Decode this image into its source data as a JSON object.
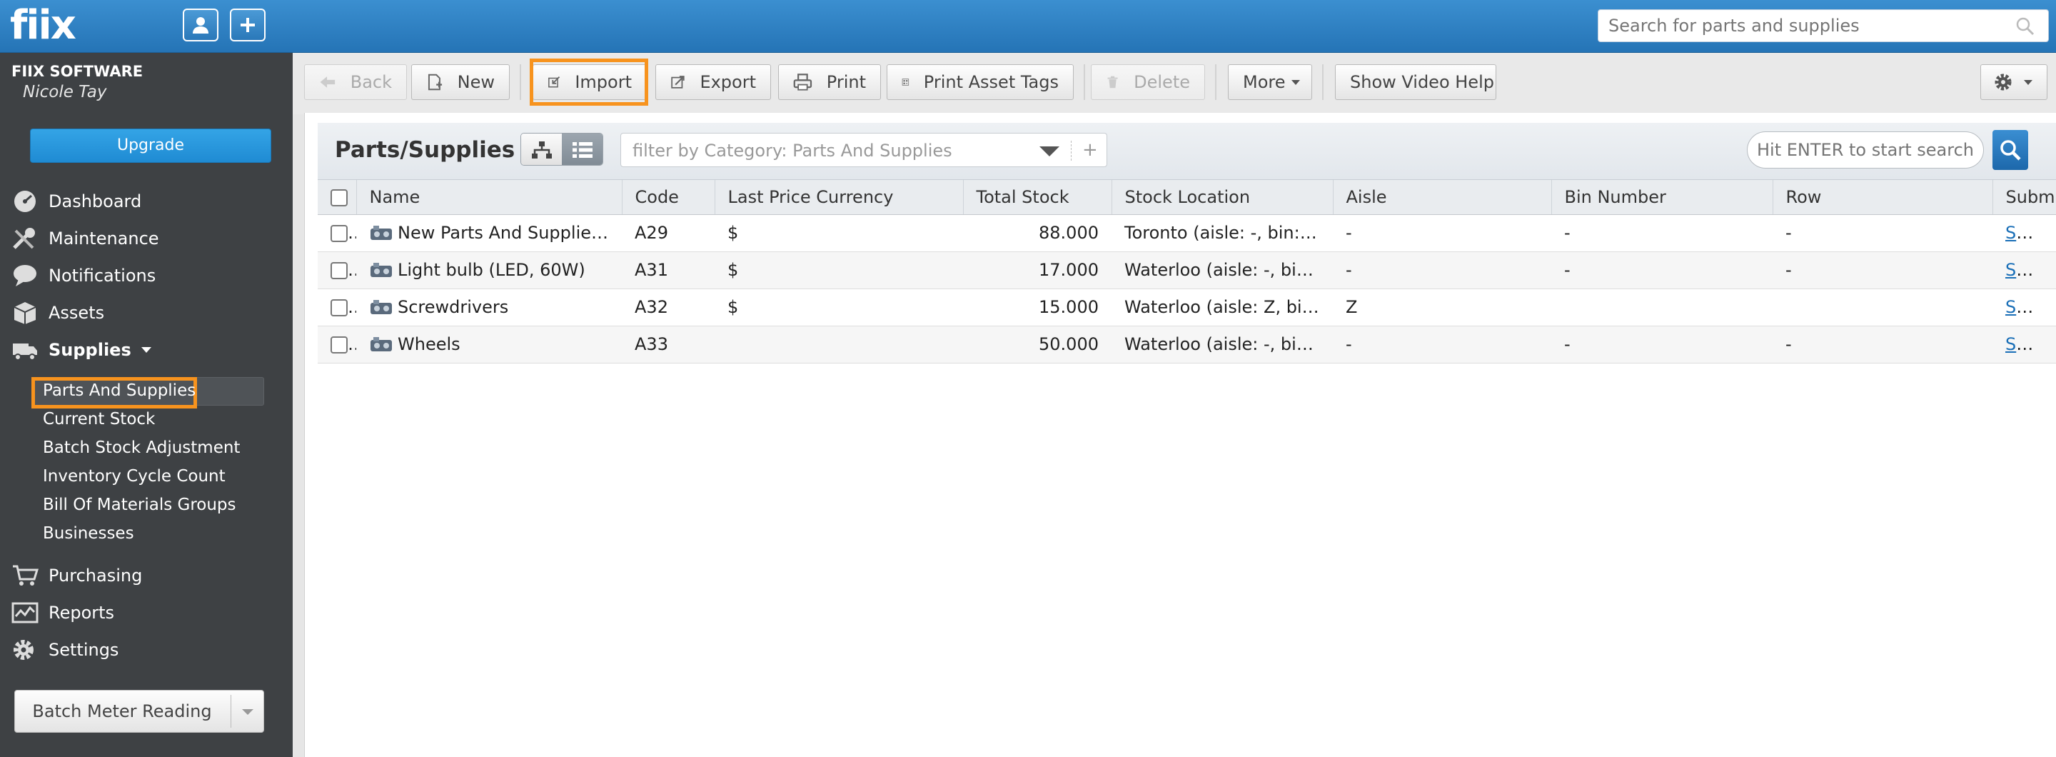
{
  "app": {
    "logo": "fiix"
  },
  "header": {
    "search_placeholder": "Search for parts and supplies"
  },
  "sidebar": {
    "company": "FIIX SOFTWARE",
    "user": "Nicole Tay",
    "upgrade_label": "Upgrade",
    "items": [
      {
        "label": "Dashboard",
        "icon": "dashboard-icon"
      },
      {
        "label": "Maintenance",
        "icon": "wrench-icon"
      },
      {
        "label": "Notifications",
        "icon": "speech-bubble-icon"
      },
      {
        "label": "Assets",
        "icon": "box-icon"
      },
      {
        "label": "Supplies",
        "icon": "truck-icon"
      },
      {
        "label": "Purchasing",
        "icon": "cart-icon"
      },
      {
        "label": "Reports",
        "icon": "chart-icon"
      },
      {
        "label": "Settings",
        "icon": "gear-icon"
      }
    ],
    "supplies_sub": [
      "Parts And Supplies",
      "Current Stock",
      "Batch Stock Adjustment",
      "Inventory Cycle Count",
      "Bill Of Materials Groups",
      "Businesses"
    ],
    "batch_meter_label": "Batch Meter Reading"
  },
  "toolbar": {
    "back": "Back",
    "new": "New",
    "import": "Import",
    "export": "Export",
    "print": "Print",
    "print_tags": "Print Asset Tags",
    "delete": "Delete",
    "more": "More",
    "video_help": "Show Video Help"
  },
  "panel": {
    "title": "Parts/Supplies",
    "filter_placeholder": "filter by Category: Parts And Supplies",
    "filter_add": "+",
    "search_placeholder": "Hit ENTER to start search"
  },
  "table": {
    "columns": [
      "Name",
      "Code",
      "Last Price Currency",
      "Total Stock",
      "Stock Location",
      "Aisle",
      "Bin Number",
      "Row",
      "Submi"
    ],
    "rows": [
      {
        "name": "New Parts And Supplies ...",
        "code": "A29",
        "currency": "$",
        "stock": "88.000",
        "location": "Toronto (aisle: -, bin: -, ro...",
        "aisle": "-",
        "bin": "-",
        "row": "-",
        "submit": "Submi"
      },
      {
        "name": "Light bulb (LED, 60W)",
        "code": "A31",
        "currency": "$",
        "stock": "17.000",
        "location": "Waterloo (aisle: -, bin: -, r...",
        "aisle": "-",
        "bin": "-",
        "row": "-",
        "submit": "Submi"
      },
      {
        "name": "Screwdrivers",
        "code": "A32",
        "currency": "$",
        "stock": "15.000",
        "location": "Waterloo (aisle: Z, bin: , r...",
        "aisle": "Z",
        "bin": "",
        "row": "",
        "submit": "Submi"
      },
      {
        "name": "Wheels",
        "code": "A33",
        "currency": "",
        "stock": "50.000",
        "location": "Waterloo (aisle: -, bin: -, r...",
        "aisle": "-",
        "bin": "-",
        "row": "-",
        "submit": "Submi"
      }
    ]
  },
  "colors": {
    "accent": "#2574b6",
    "highlight": "#f7931e",
    "sidebar_bg": "#3e4144"
  }
}
